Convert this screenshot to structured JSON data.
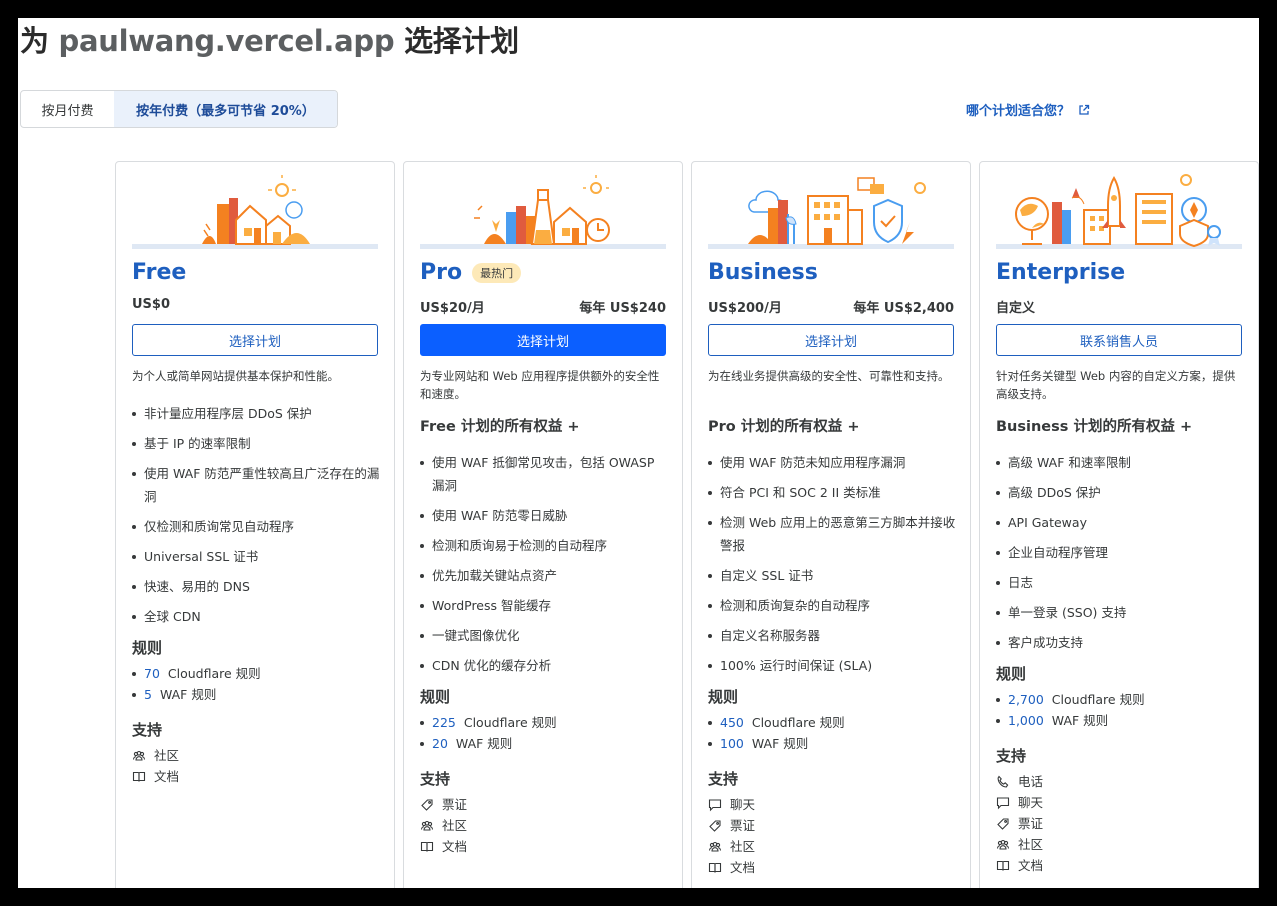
{
  "page_title": {
    "prefix": "为",
    "domain": "paulwang.vercel.app",
    "suffix": "选择计划"
  },
  "billing": {
    "monthly_label": "按月付费",
    "yearly_label": "按年付费（最多可节省 20%）",
    "selected": "yearly"
  },
  "which_plan_link": {
    "label": "哪个计划适合您？",
    "icon": "external-link-icon"
  },
  "colors": {
    "accent": "#1e5fbf",
    "primary_button": "#0b5fff",
    "toggle_selected_bg": "#eaf1fb",
    "badge_bg": "#fde9b8",
    "illustration_orange": "#f48120"
  },
  "plans": [
    {
      "id": "free",
      "name": "Free",
      "badge": "",
      "price": "US$0",
      "yearly_price": "",
      "cta": "选择计划",
      "cta_primary": false,
      "description": "为个人或简单网站提供基本保护和性能。",
      "all_of": "",
      "features": [
        "非计量应用程序层 DDoS 保护",
        "基于 IP 的速率限制",
        "使用 WAF 防范严重性较高且广泛存在的漏洞",
        "仅检测和质询常见自动程序",
        "Universal SSL 证书",
        "快速、易用的 DNS",
        "全球 CDN"
      ],
      "rules_heading": "规则",
      "rules": [
        {
          "count": "70",
          "label": "Cloudflare 规则"
        },
        {
          "count": "5",
          "label": "WAF 规则"
        }
      ],
      "support_heading": "支持",
      "support": [
        {
          "icon": "community-icon",
          "label": "社区"
        },
        {
          "icon": "docs-icon",
          "label": "文档"
        }
      ]
    },
    {
      "id": "pro",
      "name": "Pro",
      "badge": "最热门",
      "price": "US$20/月",
      "yearly_price": "每年 US$240",
      "cta": "选择计划",
      "cta_primary": true,
      "description": "为专业网站和 Web 应用程序提供额外的安全性和速度。",
      "all_of": "Free 计划的所有权益 +",
      "features": [
        "使用 WAF 抵御常见攻击，包括 OWASP 漏洞",
        "使用 WAF 防范零日威胁",
        "检测和质询易于检测的自动程序",
        "优先加载关键站点资产",
        "WordPress 智能缓存",
        "一键式图像优化",
        "CDN 优化的缓存分析"
      ],
      "rules_heading": "规则",
      "rules": [
        {
          "count": "225",
          "label": "Cloudflare 规则"
        },
        {
          "count": "20",
          "label": "WAF 规则"
        }
      ],
      "support_heading": "支持",
      "support": [
        {
          "icon": "ticket-icon",
          "label": "票证"
        },
        {
          "icon": "community-icon",
          "label": "社区"
        },
        {
          "icon": "docs-icon",
          "label": "文档"
        }
      ]
    },
    {
      "id": "business",
      "name": "Business",
      "badge": "",
      "price": "US$200/月",
      "yearly_price": "每年 US$2,400",
      "cta": "选择计划",
      "cta_primary": false,
      "description": "为在线业务提供高级的安全性、可靠性和支持。",
      "all_of": "Pro 计划的所有权益 +",
      "features": [
        "使用 WAF 防范未知应用程序漏洞",
        "符合 PCI 和 SOC 2 II 类标准",
        "检测 Web 应用上的恶意第三方脚本并接收警报",
        "自定义 SSL 证书",
        "检测和质询复杂的自动程序",
        "自定义名称服务器",
        "100% 运行时间保证 (SLA)"
      ],
      "rules_heading": "规则",
      "rules": [
        {
          "count": "450",
          "label": "Cloudflare 规则"
        },
        {
          "count": "100",
          "label": "WAF 规则"
        }
      ],
      "support_heading": "支持",
      "support": [
        {
          "icon": "chat-icon",
          "label": "聊天"
        },
        {
          "icon": "ticket-icon",
          "label": "票证"
        },
        {
          "icon": "community-icon",
          "label": "社区"
        },
        {
          "icon": "docs-icon",
          "label": "文档"
        }
      ]
    },
    {
      "id": "enterprise",
      "name": "Enterprise",
      "badge": "",
      "price": "自定义",
      "yearly_price": "",
      "cta": "联系销售人员",
      "cta_primary": false,
      "description": "针对任务关键型 Web 内容的自定义方案，提供高级支持。",
      "all_of": "Business 计划的所有权益 +",
      "features": [
        "高级 WAF 和速率限制",
        "高级 DDoS 保护",
        "API Gateway",
        "企业自动程序管理",
        "日志",
        "单一登录 (SSO) 支持",
        "客户成功支持"
      ],
      "rules_heading": "规则",
      "rules": [
        {
          "count": "2,700",
          "label": "Cloudflare 规则"
        },
        {
          "count": "1,000",
          "label": "WAF 规则"
        }
      ],
      "support_heading": "支持",
      "support": [
        {
          "icon": "phone-icon",
          "label": "电话"
        },
        {
          "icon": "chat-icon",
          "label": "聊天"
        },
        {
          "icon": "ticket-icon",
          "label": "票证"
        },
        {
          "icon": "community-icon",
          "label": "社区"
        },
        {
          "icon": "docs-icon",
          "label": "文档"
        }
      ]
    }
  ]
}
